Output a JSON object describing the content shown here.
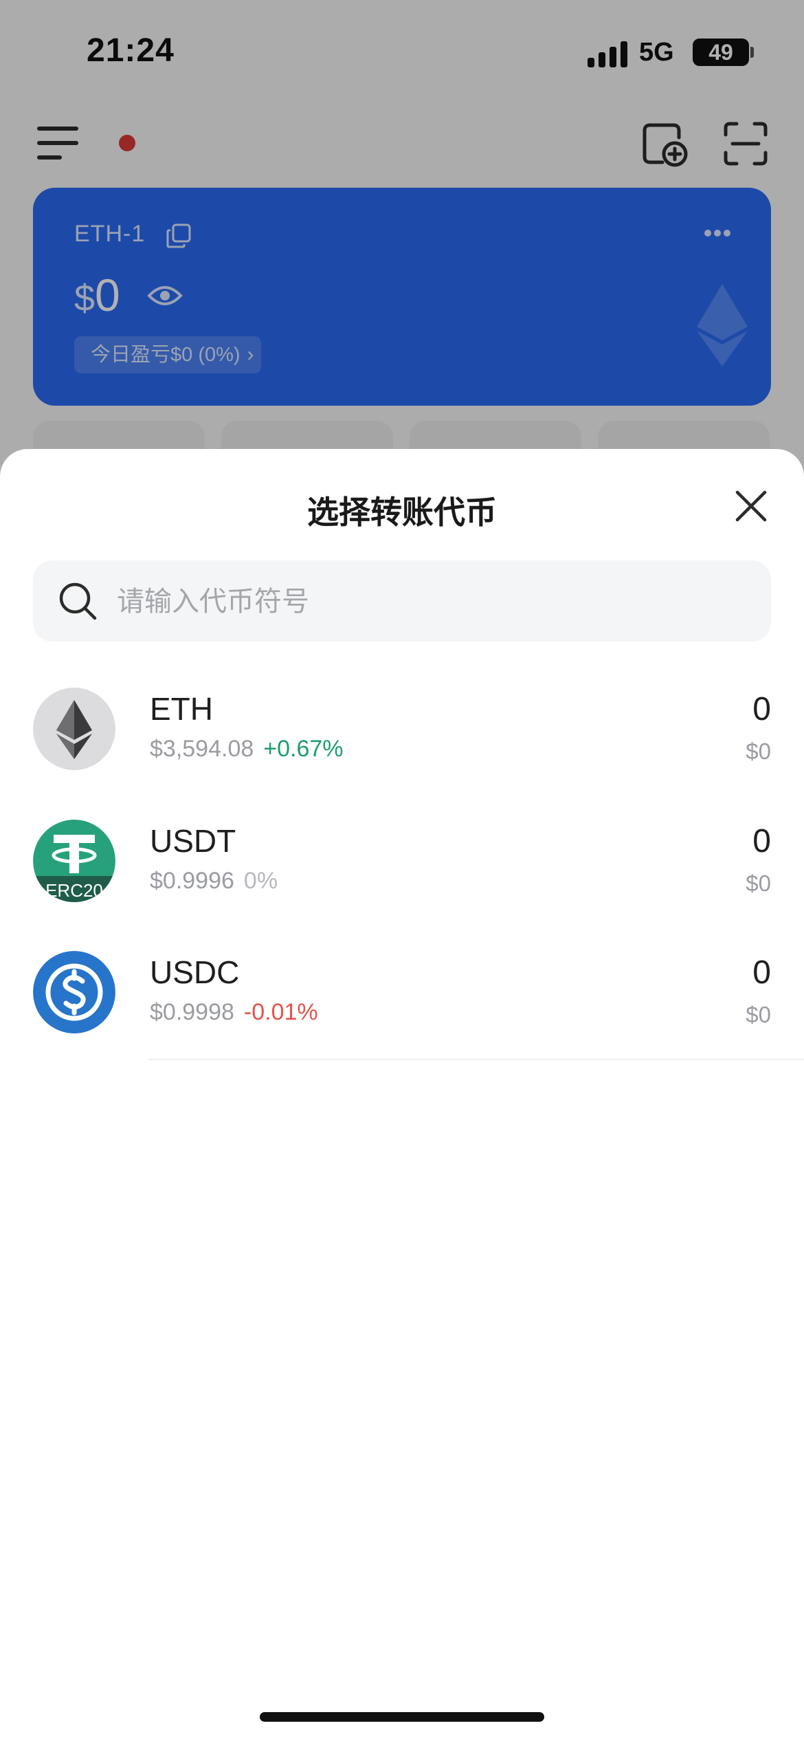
{
  "status_bar": {
    "time": "21:24",
    "network": "5G",
    "battery": "49"
  },
  "account_card": {
    "name": "ETH-1",
    "currency_symbol": "$",
    "balance": "0",
    "today_pnl": "今日盈亏$0 (0%)"
  },
  "sheet": {
    "title": "选择转账代币",
    "search_placeholder": "请输入代币符号",
    "tokens": [
      {
        "symbol": "ETH",
        "price": "$3,594.08",
        "change": "+0.67%",
        "change_color": "#1e9e6e",
        "amount": "0",
        "value": "$0",
        "icon": "ethereum-logo"
      },
      {
        "symbol": "USDT",
        "price": "$0.9996",
        "change": "0%",
        "change_color": "#b7b9bd",
        "amount": "0",
        "value": "$0",
        "icon": "tether-logo",
        "badge": "ERC20"
      },
      {
        "symbol": "USDC",
        "price": "$0.9998",
        "change": "-0.01%",
        "change_color": "#e5524a",
        "amount": "0",
        "value": "$0",
        "icon": "usdc-logo"
      }
    ]
  }
}
